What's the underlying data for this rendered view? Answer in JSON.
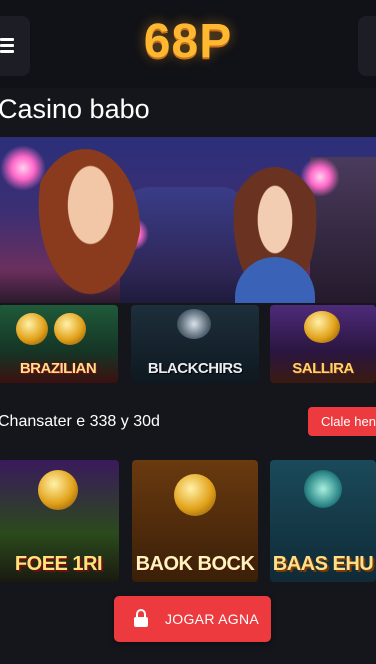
{
  "header": {
    "logo_text": "68P",
    "menu_icon": "hamburger-menu-icon",
    "right_icon": "more-icon"
  },
  "page": {
    "title": "Casino babo"
  },
  "hero": {
    "alt_icon": "hero-banner-image"
  },
  "games_row_1": [
    {
      "title": "ВRAZILIAN"
    },
    {
      "title": "BLACKCHIRS"
    },
    {
      "title": "SALLIRA"
    }
  ],
  "promo": {
    "text": "Chansater e 338 y 30d",
    "button_label": "Clale hensa"
  },
  "games_row_2": [
    {
      "title": "FOEE 1RI"
    },
    {
      "title": "BAOK BOCK"
    },
    {
      "title": "BAAS EHU"
    }
  ],
  "cta": {
    "label": "JOGAR AGNA",
    "icon": "lock-icon"
  },
  "colors": {
    "background": "#15161c",
    "accent_red": "#ec3a3e",
    "logo_gold": "#ffb830"
  }
}
